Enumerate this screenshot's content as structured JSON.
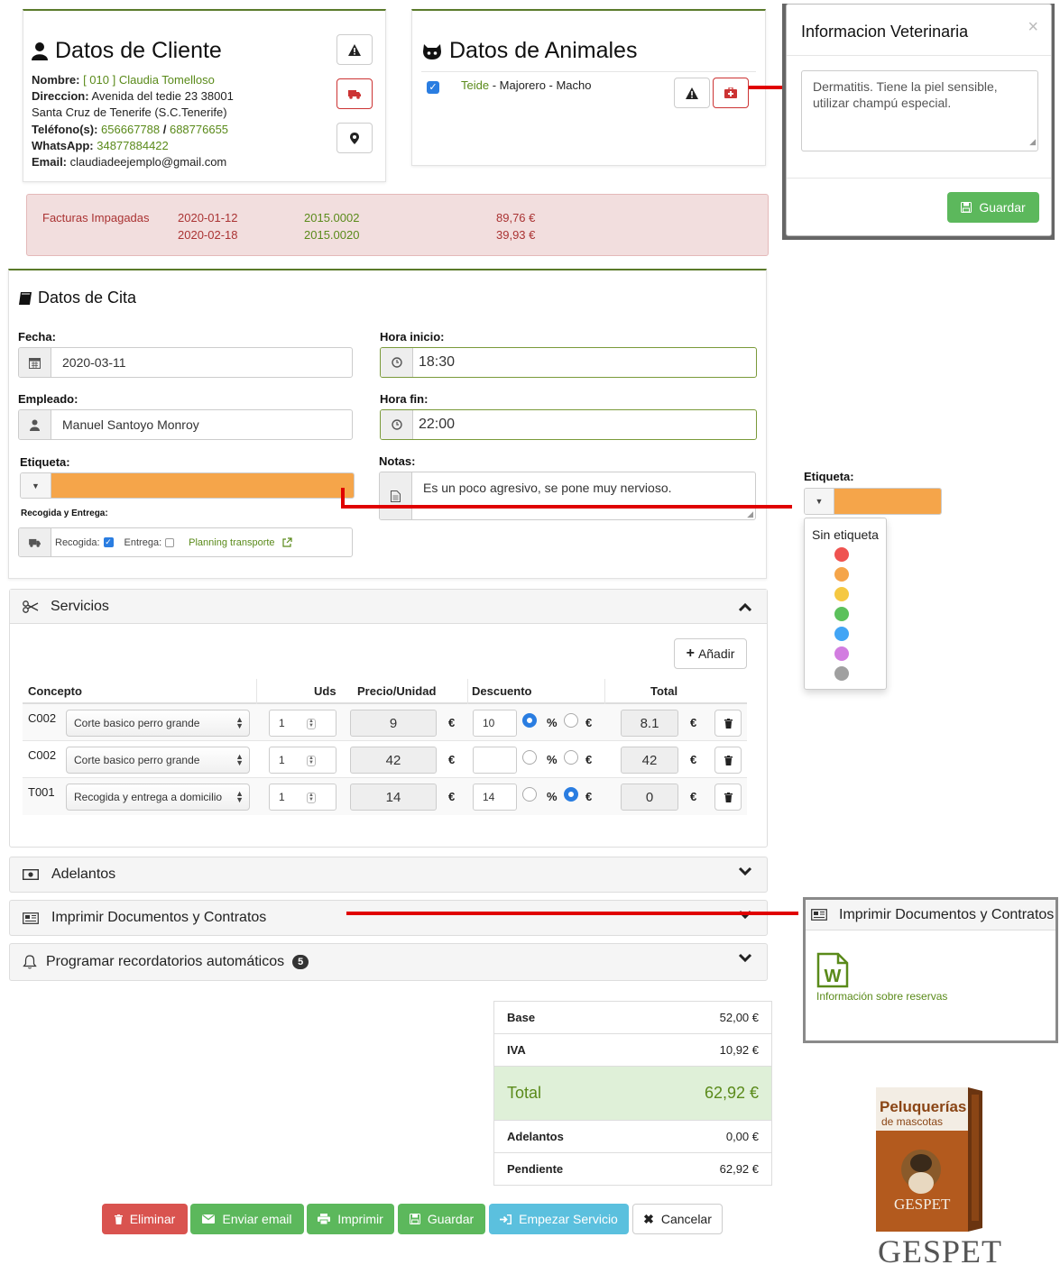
{
  "client": {
    "title": "Datos de Cliente",
    "nombre_label": "Nombre:",
    "nombre_code": "[ 010 ]",
    "nombre_value": "Claudia Tomelloso",
    "direccion_label": "Direccion:",
    "direccion_value": "Avenida del tedie 23   38001",
    "direccion_line2": "Santa Cruz de Tenerife (S.C.Tenerife)",
    "telefono_label": "Teléfono(s):",
    "telefono_1": "656667788",
    "telefono_sep": " / ",
    "telefono_2": "688776655",
    "whatsapp_label": "WhatsApp:",
    "whatsapp_value": "34877884422",
    "email_label": "Email:",
    "email_value": "claudiadeejemplo@gmail.com"
  },
  "animals": {
    "title": "Datos de Animales",
    "animal_name": "Teide",
    "animal_desc": " - Majorero - Macho",
    "checked": true
  },
  "vet_modal": {
    "title": "Informacion Veterinaria",
    "close": "×",
    "text": "Dermatitis. Tiene la piel sensible, utilizar champú especial.",
    "save_label": "Guardar",
    "save_color": "#5cb85c"
  },
  "unpaid": {
    "label": "Facturas Impagadas",
    "rows": [
      {
        "date": "2020-01-12",
        "invoice": "2015.0002",
        "amount": "89,76 €"
      },
      {
        "date": "2020-02-18",
        "invoice": "2015.0020",
        "amount": "39,93 €"
      }
    ]
  },
  "cita": {
    "title": "Datos de Cita",
    "fecha_label": "Fecha:",
    "fecha_value": "2020-03-11",
    "hora_inicio_label": "Hora inicio:",
    "hora_inicio_value": "18:30",
    "empleado_label": "Empleado:",
    "empleado_value": "Manuel Santoyo Monroy",
    "hora_fin_label": "Hora fin:",
    "hora_fin_value": "22:00",
    "etiqueta_label": "Etiqueta:",
    "etiqueta_color": "#f5a54a",
    "notas_label": "Notas:",
    "notas_value": "Es un poco agresivo, se pone muy nervioso.",
    "recogida_entrega_label": "Recogida y Entrega:",
    "recogida_label": "Recogida:",
    "recogida_checked": true,
    "entrega_label": "Entrega:",
    "entrega_checked": false,
    "planning_label": "Planning transporte"
  },
  "etiqueta_dropdown": {
    "label": "Etiqueta:",
    "selected_color": "#f5a54a",
    "none_label": "Sin etiqueta",
    "colors": [
      "#ef5350",
      "#f5a54a",
      "#f5c842",
      "#5cc15c",
      "#42a5f5",
      "#d27de0",
      "#a0a0a0"
    ]
  },
  "servicios": {
    "title": "Servicios",
    "add_label": "Añadir",
    "columns": [
      "Concepto",
      "Uds",
      "Precio/Unidad",
      "Descuento",
      "Total"
    ],
    "rows": [
      {
        "code": "C002",
        "concept": "Corte basico perro grande",
        "uds": "1",
        "price": "9",
        "discount": "10",
        "disc_type": "%",
        "total": "8.1"
      },
      {
        "code": "C002",
        "concept": "Corte basico perro grande",
        "uds": "1",
        "price": "42",
        "discount": "",
        "disc_type": "",
        "total": "42"
      },
      {
        "code": "T001",
        "concept": "Recogida y entrega a domicilio",
        "uds": "1",
        "price": "14",
        "discount": "14",
        "disc_type": "€",
        "total": "0"
      }
    ],
    "pct_symbol": "%",
    "eur_symbol": "€"
  },
  "accordions": {
    "adelantos": "Adelantos",
    "imprimir": "Imprimir Documentos y Contratos",
    "recordatorios": "Programar recordatorios automáticos",
    "recordatorios_badge": "5"
  },
  "print_popup": {
    "title": "Imprimir Documentos y Contratos",
    "doc_label": "Información sobre reservas"
  },
  "totals": {
    "base_label": "Base",
    "base_value": "52,00 €",
    "iva_label": "IVA",
    "iva_value": "10,92 €",
    "total_label": "Total",
    "total_value": "62,92 €",
    "adelantos_label": "Adelantos",
    "adelantos_value": "0,00 €",
    "pendiente_label": "Pendiente",
    "pendiente_value": "62,92 €"
  },
  "actions": {
    "eliminar": "Eliminar",
    "enviar_email": "Enviar email",
    "imprimir": "Imprimir",
    "guardar": "Guardar",
    "empezar": "Empezar Servicio",
    "cancelar": "Cancelar"
  },
  "brand": {
    "box_title": "Peluquerías",
    "box_subtitle": "de mascotas",
    "box_brand": "GESPET",
    "logo": "GESPET"
  }
}
